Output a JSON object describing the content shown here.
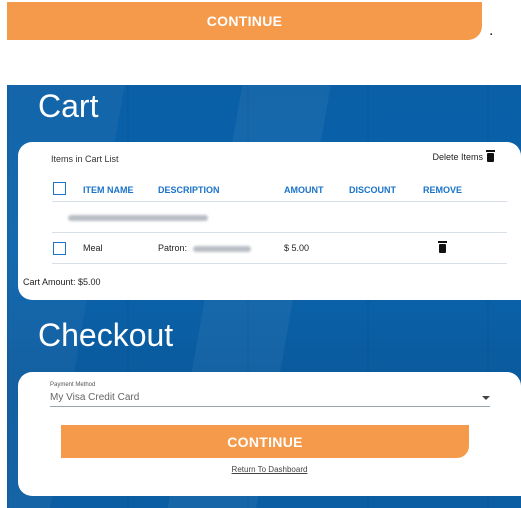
{
  "top": {
    "continue_label": "CONTINUE",
    "dot": "."
  },
  "cart": {
    "title": "Cart",
    "list_label": "Items in Cart List",
    "delete_items_label": "Delete Items",
    "headers": [
      "ITEM NAME",
      "DESCRIPTION",
      "AMOUNT",
      "DISCOUNT",
      "REMOVE"
    ],
    "items": [
      {
        "name": "Meal",
        "description_prefix": "Patron:",
        "amount": "$ 5.00",
        "discount": ""
      }
    ],
    "amount_label": "Cart Amount: $5.00"
  },
  "checkout": {
    "title": "Checkout",
    "payment_label": "Payment Method",
    "payment_value": "My Visa Credit Card",
    "continue_label": "CONTINUE",
    "return_link": "Return To Dashboard"
  },
  "colors": {
    "accent": "#f49a4a",
    "primary": "#1a73c9",
    "background": "#0b64ad"
  },
  "icons": [
    "trash-icon",
    "checkbox-icon",
    "chevron-down-icon"
  ]
}
